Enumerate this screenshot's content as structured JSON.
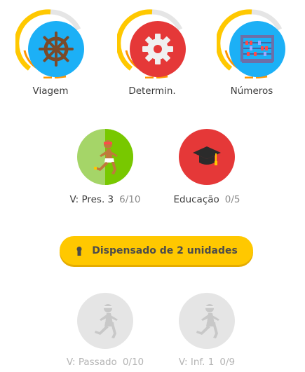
{
  "top_row": [
    {
      "label": "Viagem",
      "icon": "ship-wheel-icon",
      "color": "#1cb0f6"
    },
    {
      "label": "Determin.",
      "icon": "gear-icon",
      "color": "#e53838"
    },
    {
      "label": "Números",
      "icon": "abacus-icon",
      "color": "#1cb0f6"
    }
  ],
  "middle_row": [
    {
      "label": "V: Pres. 3",
      "count": "6/10",
      "icon": "runner-icon",
      "color": "#78c800"
    },
    {
      "label": "Educação",
      "count": "0/5",
      "icon": "graduation-cap-icon",
      "color": "#e53838"
    }
  ],
  "banner": {
    "text": "Dispensado de 2 unidades",
    "icon": "keyhole-icon",
    "color": "#ffc800"
  },
  "locked_row": [
    {
      "label": "V: Passado",
      "count": "0/10",
      "icon": "runner-icon"
    },
    {
      "label": "V: Inf. 1",
      "count": "0/9",
      "icon": "runner-icon"
    }
  ]
}
